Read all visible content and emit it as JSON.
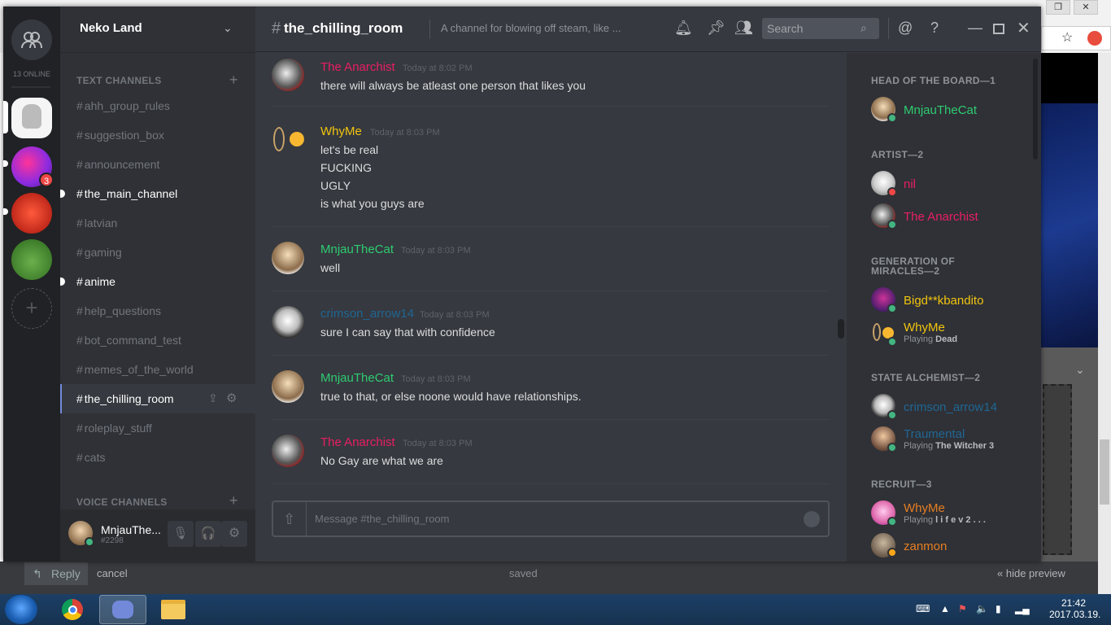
{
  "server": {
    "name": "Neko Land",
    "online_label": "13 ONLINE",
    "mention_badge": "3"
  },
  "channels": {
    "text_header": "TEXT CHANNELS",
    "voice_header": "VOICE CHANNELS",
    "items": [
      "ahh_group_rules",
      "suggestion_box",
      "announcement",
      "the_main_channel",
      "latvian",
      "gaming",
      "anime",
      "help_questions",
      "bot_command_test",
      "memes_of_the_world",
      "the_chilling_room",
      "roleplay_stuff",
      "cats"
    ],
    "hash": "#"
  },
  "user": {
    "name": "MnjauThe...",
    "tag": "#2298"
  },
  "header": {
    "channel": "the_chilling_room",
    "topic": "A channel for blowing off steam, like ...",
    "search_placeholder": "Search"
  },
  "messages": [
    {
      "author": "The Anarchist",
      "time": "Today at 8:02 PM",
      "color": "#e91e63",
      "lines": [
        "there will always be atleast one person that likes you"
      ]
    },
    {
      "author": "WhyMe",
      "time": "Today at 8:03 PM",
      "color": "#f1c40f",
      "lines": [
        "let's be real",
        "FUCKING",
        "UGLY",
        "is what you guys are"
      ]
    },
    {
      "author": "MnjauTheCat",
      "time": "Today at 8:03 PM",
      "color": "#2ecc71",
      "lines": [
        "well"
      ]
    },
    {
      "author": "crimson_arrow14",
      "time": "Today at 8:03 PM",
      "color": "#206694",
      "lines": [
        "sure I can say that with confidence"
      ]
    },
    {
      "author": "MnjauTheCat",
      "time": "Today at 8:03 PM",
      "color": "#2ecc71",
      "lines": [
        "true to that, or else noone would have relationships."
      ]
    },
    {
      "author": "The Anarchist",
      "time": "Today at 8:03 PM",
      "color": "#e91e63",
      "lines": [
        "No Gay are what we are"
      ]
    }
  ],
  "composer": {
    "placeholder": "Message #the_chilling_room"
  },
  "members": {
    "roles": [
      "HEAD OF THE BOARD—1",
      "ARTIST—2",
      "GENERATION OF MIRACLES—2",
      "STATE ALCHEMIST—2",
      "RECRUIT—3"
    ],
    "list": [
      {
        "name": "MnjauTheCat",
        "color": "#2ecc71",
        "status": "online"
      },
      {
        "name": "nil",
        "color": "#e91e63",
        "status": "dnd"
      },
      {
        "name": "The Anarchist",
        "color": "#e91e63",
        "status": "online"
      },
      {
        "name": "Bigd**kbandito",
        "color": "#f1c40f",
        "status": "online"
      },
      {
        "name": "WhyMe",
        "color": "#f1c40f",
        "status": "online",
        "playing_prefix": "Playing ",
        "playing": "Dead"
      },
      {
        "name": "crimson_arrow14",
        "color": "#206694",
        "status": "online"
      },
      {
        "name": "Traumental",
        "color": "#206694",
        "status": "online",
        "playing_prefix": "Playing ",
        "playing": "The Witcher 3"
      },
      {
        "name": "WhyMe",
        "color": "#e67e22",
        "status": "online",
        "playing_prefix": "Playing ",
        "playing": "l i f e  v 2 . . ."
      },
      {
        "name": "zanmon",
        "color": "#e67e22",
        "status": "idle"
      }
    ]
  },
  "browser": {
    "reply_label": "Reply",
    "cancel_label": "cancel",
    "saved_label": "saved",
    "hide_preview_label": "« hide preview"
  },
  "taskbar": {
    "time": "21:42",
    "date": "2017.03.19."
  }
}
